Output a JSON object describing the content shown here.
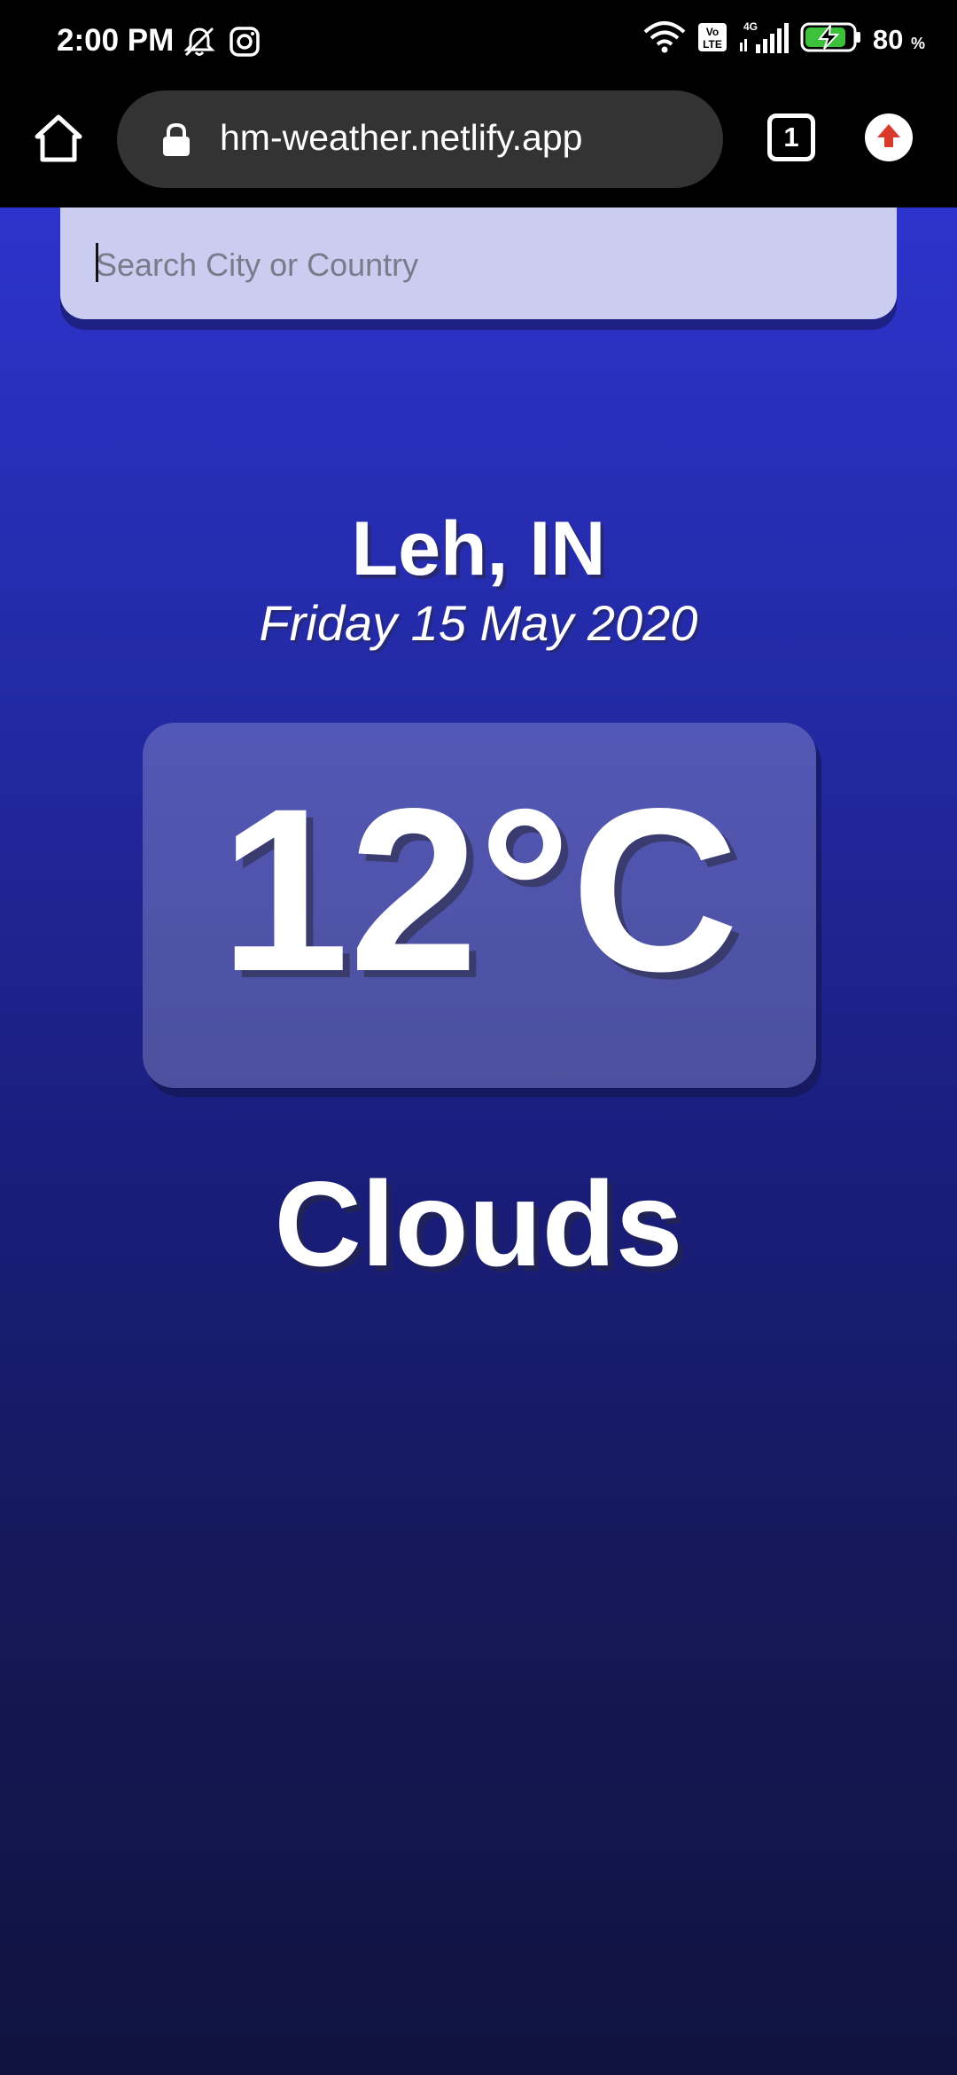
{
  "status_bar": {
    "time": "2:00 PM",
    "icons": [
      "notifications-off-icon",
      "instagram-icon",
      "wifi-icon",
      "volte-icon",
      "signal-4g-icon",
      "battery-charging-icon"
    ],
    "battery_percent": "80",
    "battery_unit": "%"
  },
  "browser": {
    "url": "hm-weather.netlify.app",
    "tab_count": "1",
    "icons": [
      "home-icon",
      "lock-icon",
      "tabs-icon",
      "update-icon"
    ]
  },
  "search": {
    "placeholder": "Search City or Country",
    "value": ""
  },
  "weather": {
    "location": "Leh, IN",
    "date": "Friday 15 May 2020",
    "temperature": "12°C",
    "condition": "Clouds"
  },
  "colors": {
    "gradient_top": "#2d33cc",
    "gradient_bottom": "#10133f",
    "search_bg": "#cbcdf0",
    "update_accent": "#d93a2b"
  }
}
